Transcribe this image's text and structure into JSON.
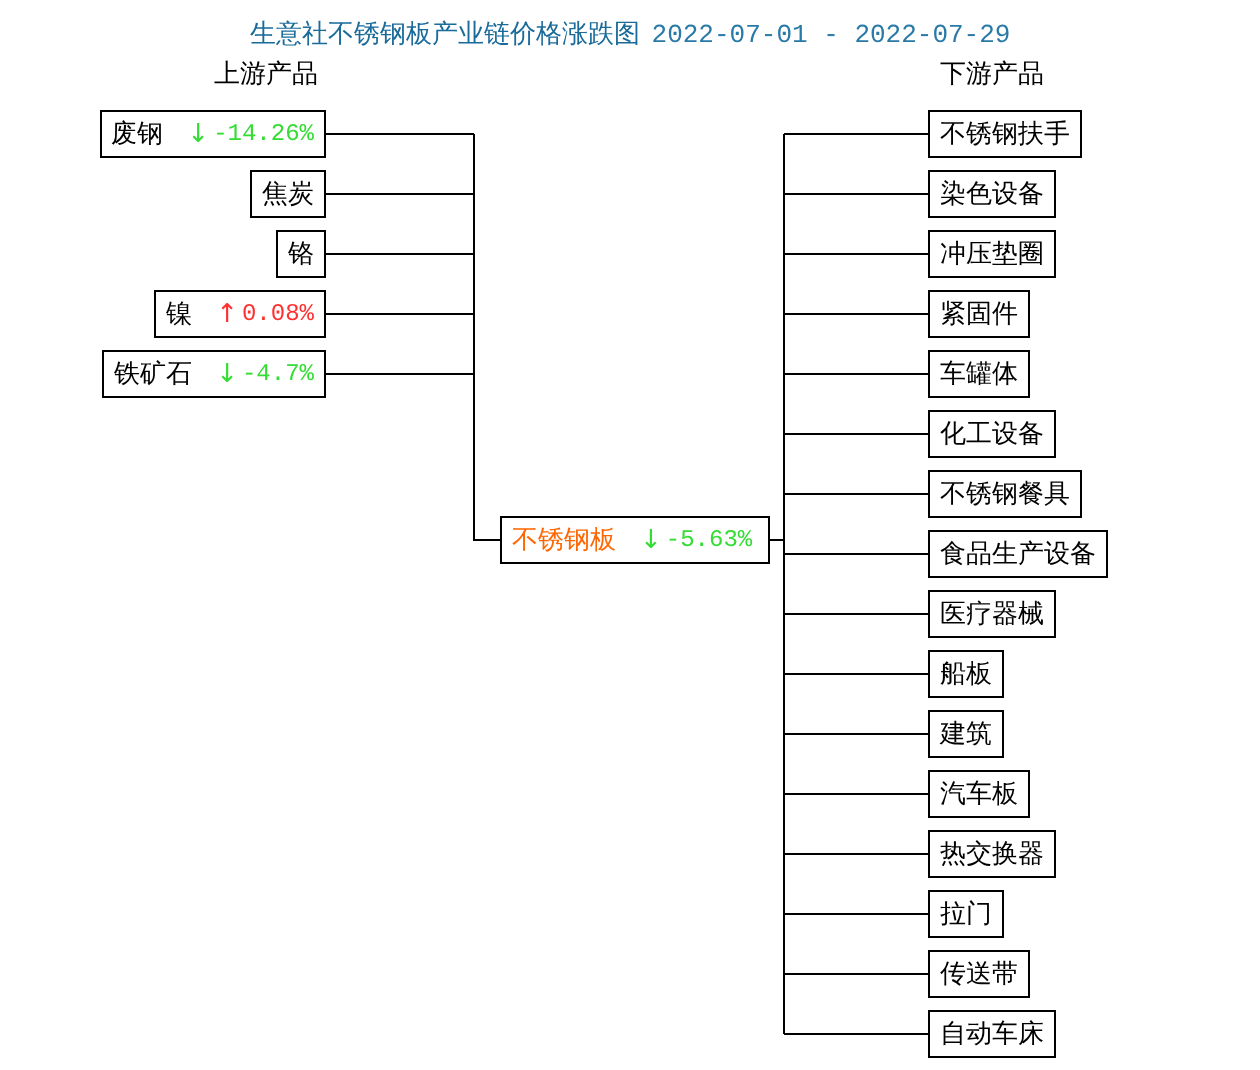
{
  "title": "生意社不锈钢板产业链价格涨跌图",
  "date_range": "2022-07-01 - 2022-07-29",
  "upstream": {
    "heading": "上游产品",
    "items": [
      {
        "name": "废钢",
        "arrow": "↓",
        "change": "-14.26%",
        "color": "#33dd33"
      },
      {
        "name": "焦炭"
      },
      {
        "name": "铬"
      },
      {
        "name": "镍",
        "arrow": "↑",
        "change": "0.08%",
        "color": "#ff3030"
      },
      {
        "name": "铁矿石",
        "arrow": "↓",
        "change": "-4.7%",
        "color": "#33dd33"
      }
    ]
  },
  "center": {
    "name": "不锈钢板",
    "arrow": "↓",
    "change": "-5.63%",
    "color": "#33dd33"
  },
  "downstream": {
    "heading": "下游产品",
    "items": [
      {
        "name": "不锈钢扶手"
      },
      {
        "name": "染色设备"
      },
      {
        "name": "冲压垫圈"
      },
      {
        "name": "紧固件"
      },
      {
        "name": "车罐体"
      },
      {
        "name": "化工设备"
      },
      {
        "name": "不锈钢餐具"
      },
      {
        "name": "食品生产设备"
      },
      {
        "name": "医疗器械"
      },
      {
        "name": "船板"
      },
      {
        "name": "建筑"
      },
      {
        "name": "汽车板"
      },
      {
        "name": "热交换器"
      },
      {
        "name": "拉门"
      },
      {
        "name": "传送带"
      },
      {
        "name": "自动车床"
      }
    ]
  }
}
